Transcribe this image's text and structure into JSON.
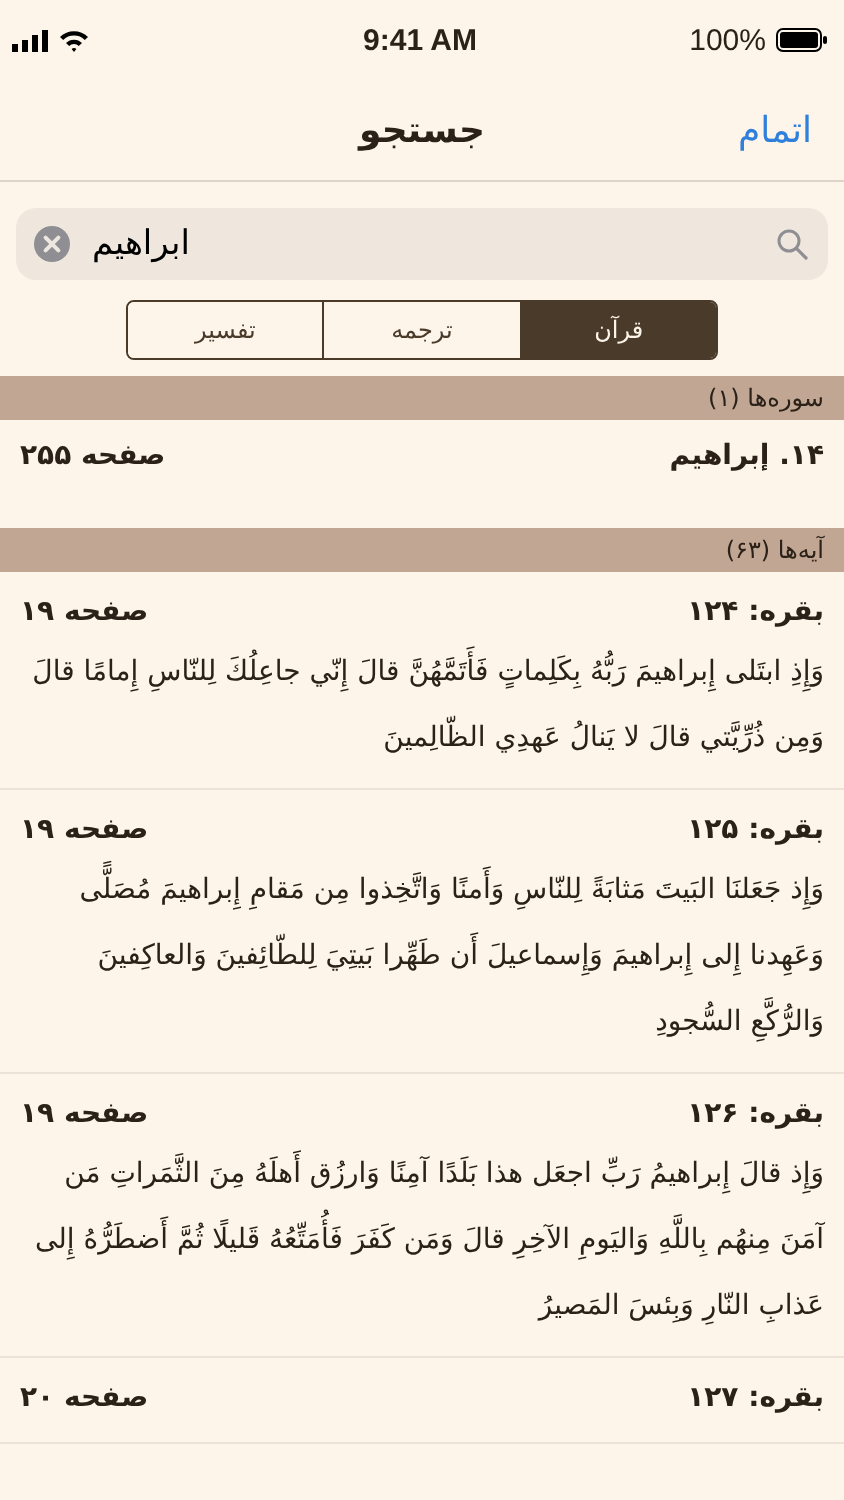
{
  "status_bar": {
    "time": "9:41 AM",
    "battery": "100%"
  },
  "nav": {
    "title": "جستجو",
    "done": "اتمام"
  },
  "search": {
    "value": "ابراهیم"
  },
  "segments": [
    {
      "label": "قرآن",
      "selected": true
    },
    {
      "label": "ترجمه",
      "selected": false
    },
    {
      "label": "تفسیر",
      "selected": false
    }
  ],
  "surahs": {
    "header": "سوره‌ها (۱)",
    "items": [
      {
        "name": "۱۴. إبراهيم",
        "page": "صفحه ۲۵۵"
      }
    ]
  },
  "verses": {
    "header": "آیه‌ها (۶۳)",
    "items": [
      {
        "ref": "بقره: ۱۲۴",
        "page": "صفحه ۱۹",
        "text": "وَإِذِ ابتَلى إِبراهيمَ رَبُّهُ بِكَلِماتٍ فَأَتَمَّهُنَّ قالَ إِنّي جاعِلُكَ لِلنّاسِ إِمامًا قالَ وَمِن ذُرِّيَّتي قالَ لا يَنالُ عَهدِي الظّالِمينَ"
      },
      {
        "ref": "بقره: ۱۲۵",
        "page": "صفحه ۱۹",
        "text": "وَإِذ جَعَلنَا البَيتَ مَثابَةً لِلنّاسِ وَأَمنًا وَاتَّخِذوا مِن مَقامِ إِبراهيمَ مُصَلًّى وَعَهِدنا إِلى إِبراهيمَ وَإِسماعيلَ أَن طَهِّرا بَيتِيَ لِلطّائِفينَ وَالعاكِفينَ وَالرُّكَّعِ السُّجودِ"
      },
      {
        "ref": "بقره: ۱۲۶",
        "page": "صفحه ۱۹",
        "text": "وَإِذ قالَ إِبراهيمُ رَبِّ اجعَل هذا بَلَدًا آمِنًا وَارزُق أَهلَهُ مِنَ الثَّمَراتِ مَن آمَنَ مِنهُم بِاللَّهِ وَاليَومِ الآخِرِ قالَ وَمَن كَفَرَ فَأُمَتِّعُهُ قَليلًا ثُمَّ أَضطَرُّهُ إِلى عَذابِ النّارِ وَبِئسَ المَصيرُ"
      },
      {
        "ref": "بقره: ۱۲۷",
        "page": "صفحه ۲۰"
      }
    ]
  }
}
